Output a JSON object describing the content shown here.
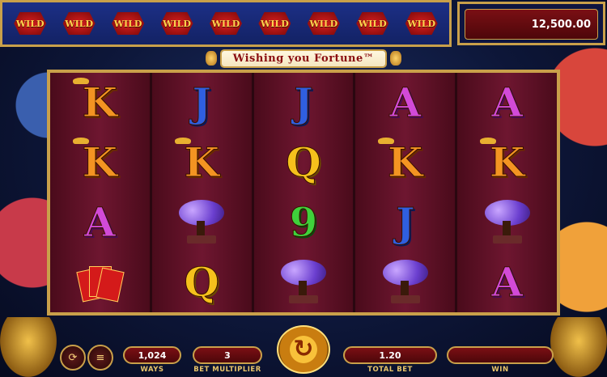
{
  "header": {
    "wild_tiles": [
      "WILD",
      "WILD",
      "WILD",
      "WILD",
      "WILD",
      "WILD",
      "WILD",
      "WILD",
      "WILD"
    ],
    "balance": "12,500.00"
  },
  "logo": {
    "title": "Wishing you Fortune™"
  },
  "reels": [
    [
      "K",
      "K",
      "A",
      "red-envelopes"
    ],
    [
      "J",
      "K",
      "bonsai",
      "Q"
    ],
    [
      "J",
      "Q",
      "9",
      "bonsai"
    ],
    [
      "A",
      "K",
      "J",
      "bonsai"
    ],
    [
      "A",
      "K",
      "bonsai",
      "A"
    ]
  ],
  "controls": {
    "ways_value": "1,024",
    "ways_label": "WAYS",
    "multiplier_value": "3",
    "multiplier_label": "BET MULTIPLIER",
    "total_bet_value": "1.20",
    "total_bet_label": "TOTAL BET",
    "win_value": "",
    "win_label": "WIN"
  },
  "colors": {
    "gold": "#c9a04a",
    "reel_bg": "#5a0f22",
    "panel_red": "#7a0f14"
  }
}
